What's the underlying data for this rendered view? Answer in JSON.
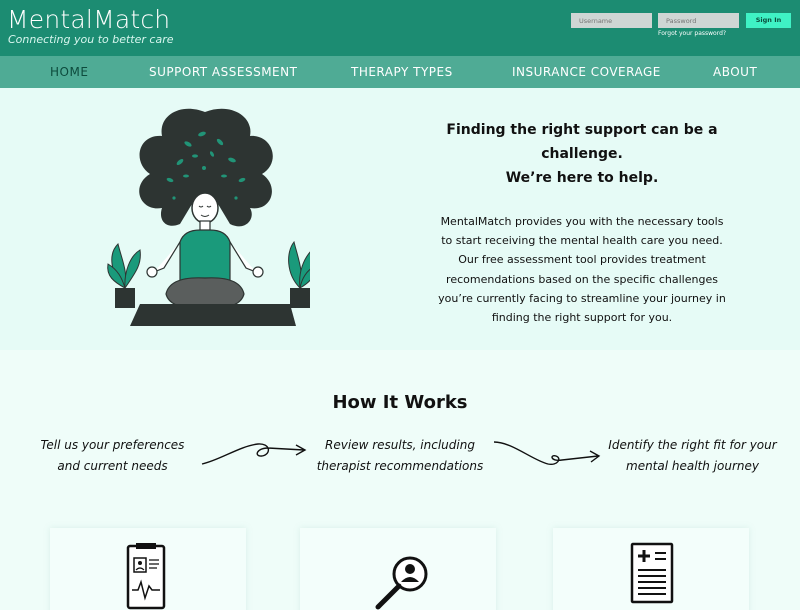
{
  "brand": {
    "title": "MentalMatch",
    "tagline": "Connecting you to better care"
  },
  "login": {
    "username_placeholder": "Username",
    "password_placeholder": "Password",
    "signin_label": "Sign In",
    "forgot_label": "Forgot your password?"
  },
  "nav": {
    "items": [
      {
        "label": "HOME",
        "active": true
      },
      {
        "label": "SUPPORT ASSESSMENT"
      },
      {
        "label": "THERAPY TYPES"
      },
      {
        "label": "INSURANCE COVERAGE"
      },
      {
        "label": "ABOUT"
      }
    ]
  },
  "hero": {
    "heading_lines": [
      "Finding the right support can be a",
      "challenge.",
      "We’re here to help."
    ],
    "body_lines": [
      "MentalMatch provides you with the necessary tools",
      "to start receiving the mental health care you need.",
      "Our free assessment tool provides treatment",
      "recomendations based on the specific challenges",
      "you’re currently facing to streamline your journey in",
      "finding the right support for you."
    ]
  },
  "how": {
    "title": "How It Works",
    "steps": [
      {
        "line1": "Tell us your preferences",
        "line2": "and current needs"
      },
      {
        "line1": "Review results, including",
        "line2": "therapist recommendations"
      },
      {
        "line1": "Identify the right fit for your",
        "line2": "mental health journey"
      }
    ]
  },
  "cards": [
    {
      "icon": "clipboard-health-icon"
    },
    {
      "icon": "search-person-icon"
    },
    {
      "icon": "document-plus-icon"
    }
  ],
  "colors": {
    "header": "#1c8c72",
    "nav": "#4fab95",
    "accent": "#3ff2c5",
    "background": "#effdf9",
    "plant": "#1a9a7b"
  }
}
